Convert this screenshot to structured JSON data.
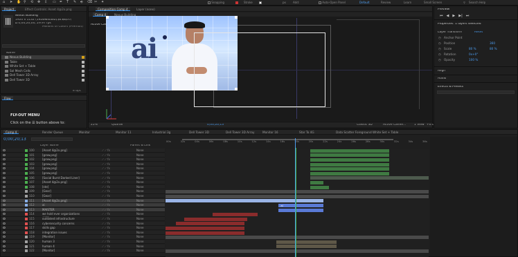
{
  "toolbar": {
    "snapping_label": "Snapping",
    "stroke_label": "Stroke",
    "stroke_value": "px",
    "add_label": "Add:",
    "auto_open_label": "Auto-Open Panel",
    "workspaces": [
      "Default",
      "Review",
      "Learn",
      "Small Screen"
    ],
    "search_placeholder": "Search Help"
  },
  "project": {
    "tabs": [
      "Project",
      "Effect Controls: Asset 4@2x.png"
    ],
    "item_name": "Nexus Building",
    "item_info": [
      "1920 x 1132 (1920 x 1132) (1.00)",
      "Δ 0;00;20;00, 29.97 fps"
    ],
    "item_info2": [
      "1920 x 1132 (1.00)",
      "Millions of Colors (Premult)"
    ],
    "col_name": "Name",
    "items": [
      {
        "name": "Nexus Building",
        "color": "#d4a017",
        "selected": true
      },
      {
        "name": "Table",
        "color": "#b8b8b8"
      },
      {
        "name": "White Set + Table",
        "color": "#b8b8b8"
      },
      {
        "name": "Sol Mesh Cells",
        "color": "#b8b8b8"
      },
      {
        "name": "Dell Tower 3D Array",
        "color": "#b8b8b8"
      },
      {
        "name": "Dell Tower 3D",
        "color": "#b8b8b8"
      }
    ],
    "bpc": "8 bpc"
  },
  "flow": {
    "tab": "Flow",
    "title": "FLY-OUT MENU",
    "instruction": "Click on the ☰ button above to:"
  },
  "comp": {
    "tabs": [
      "Composition Comp 4",
      "Layer (none)"
    ],
    "subtabs": [
      "Comp 4",
      "Nexus Building"
    ],
    "active_camera_label": "Active Camera (Camera 1)",
    "footer": {
      "zoom": "25%",
      "resolution": "Quarter",
      "timecode": "0;00;20;13",
      "renderer": "Classic 3D",
      "camera": "Active Camer...",
      "views": "1 View",
      "offset": "+0.0"
    }
  },
  "video": {
    "logo_text": "ai"
  },
  "right": {
    "preview_label": "Preview",
    "properties_label": "Properties: 1 layers selected",
    "layer_transform_label": "Layer Transform",
    "reset_label": "Reset",
    "props": [
      {
        "label": "Anchor Point",
        "value": "",
        "value2": ""
      },
      {
        "label": "Position",
        "value": "",
        "value2": "360"
      },
      {
        "label": "Scale",
        "value": "80 %",
        "value2": "80 %"
      },
      {
        "label": "Rotation",
        "value": "0x+0°",
        "value2": ""
      },
      {
        "label": "Opacity",
        "value": "100 %",
        "value2": ""
      }
    ],
    "align_label": "Align",
    "audio_label": "Audio",
    "effects_label": "Effects & Presets"
  },
  "timeline": {
    "tabs": [
      "Comp 4",
      "Render Queue",
      "Monitor",
      "Monitor 11",
      "Industrial 3g",
      "Dell Tower 3D",
      "Dell Tower 3D Array",
      "Monitor 16",
      "Star To 4G",
      "Data Scatter Foreground",
      "White Set + Table"
    ],
    "timecode": "0;00;20;13",
    "col_layer": "Layer Name",
    "col_parent": "Parent & Link",
    "ticks": [
      "00s",
      "02s",
      "04s",
      "06s",
      "08s",
      "10s",
      "12s",
      "14s",
      "16s",
      "18s",
      "20s",
      "22s",
      "24s",
      "26s",
      "28s",
      "30s",
      "32s",
      "34s",
      "36s"
    ],
    "playhead_fraction": 0.53,
    "layers": [
      {
        "num": "100",
        "name": "[Asset 4@2x.png]",
        "color": "#4caf50",
        "parent": "None"
      },
      {
        "num": "101",
        "name": "[grow.png]",
        "color": "#4caf50",
        "parent": "None"
      },
      {
        "num": "102",
        "name": "[grow.png]",
        "color": "#4caf50",
        "parent": "None"
      },
      {
        "num": "103",
        "name": "[grow.png]",
        "color": "#4caf50",
        "parent": "None"
      },
      {
        "num": "104",
        "name": "[grow.png]",
        "color": "#4caf50",
        "parent": "None"
      },
      {
        "num": "105",
        "name": "[grow.png]",
        "color": "#4caf50",
        "parent": "None"
      },
      {
        "num": "106",
        "name": "[Social Burst Darked Liner]",
        "color": "#4caf50",
        "parent": "None"
      },
      {
        "num": "107",
        "name": "[Asset 4@2x.png]",
        "color": "#4caf50",
        "parent": "None"
      },
      {
        "num": "108",
        "name": "[ste]",
        "color": "#4caf50",
        "parent": "None"
      },
      {
        "num": "109",
        "name": "[Gear]",
        "color": "#a0a0a0",
        "parent": "None"
      },
      {
        "num": "110",
        "name": "[Gear]",
        "color": "#a0a0a0",
        "parent": "None"
      },
      {
        "num": "111",
        "name": "[Asset 4@2x.png]",
        "color": "#8ab0e8",
        "parent": "None",
        "selected": true
      },
      {
        "num": "112",
        "name": "ai",
        "color": "#8ab0e8",
        "parent": "None",
        "selected": true
      },
      {
        "num": "113",
        "name": "MAISTER",
        "color": "#8ab0e8",
        "parent": "None",
        "selected": true
      },
      {
        "num": "114",
        "name": "we hold ever organizations (MCI)",
        "color": "#e05050",
        "parent": "None"
      },
      {
        "num": "115",
        "name": "outdated infrastructure",
        "color": "#e05050",
        "parent": "None"
      },
      {
        "num": "116",
        "name": "cybersecurity concerns",
        "color": "#e05050",
        "parent": "None"
      },
      {
        "num": "117",
        "name": "skills gap",
        "color": "#e05050",
        "parent": "None"
      },
      {
        "num": "118",
        "name": "integration issues",
        "color": "#e05050",
        "parent": "None"
      },
      {
        "num": "119",
        "name": "[Monitor]",
        "color": "#a0a0a0",
        "parent": "None"
      },
      {
        "num": "120",
        "name": "human 3",
        "color": "#a0a0a0",
        "parent": "None"
      },
      {
        "num": "121",
        "name": "human 4",
        "color": "#a0a0a0",
        "parent": "None"
      },
      {
        "num": "122",
        "name": "[Monitor]",
        "color": "#a0a0a0",
        "parent": "None"
      }
    ],
    "bars": [
      {
        "row": 0,
        "start": 0.55,
        "end": 0.85,
        "color": "#3f7a42",
        "label": ""
      },
      {
        "row": 1,
        "start": 0.55,
        "end": 0.85,
        "color": "#3f7a42",
        "label": ""
      },
      {
        "row": 2,
        "start": 0.55,
        "end": 0.85,
        "color": "#3f7a42",
        "label": ""
      },
      {
        "row": 3,
        "start": 0.55,
        "end": 0.85,
        "color": "#3f7a42",
        "label": ""
      },
      {
        "row": 4,
        "start": 0.55,
        "end": 0.85,
        "color": "#3f7a42",
        "label": ""
      },
      {
        "row": 5,
        "start": 0.55,
        "end": 0.85,
        "color": "#3f7a42",
        "label": ""
      },
      {
        "row": 6,
        "start": 0.55,
        "end": 1.0,
        "color": "#4d5a4d",
        "label": ""
      },
      {
        "row": 7,
        "start": 0.55,
        "end": 0.6,
        "color": "#3f7a42",
        "label": ""
      },
      {
        "row": 8,
        "start": 0.55,
        "end": 0.62,
        "color": "#3f7a42",
        "label": ""
      },
      {
        "row": 9,
        "start": 0.0,
        "end": 1.0,
        "color": "#4a4a4a",
        "label": ""
      },
      {
        "row": 10,
        "start": 0.0,
        "end": 1.0,
        "color": "#4a4a4a",
        "label": ""
      },
      {
        "row": 11,
        "start": 0.0,
        "end": 0.6,
        "color": "#9ab4e6",
        "label": ""
      },
      {
        "row": 12,
        "start": 0.43,
        "end": 0.6,
        "color": "#5a7ad6",
        "label": "ai"
      },
      {
        "row": 13,
        "start": 0.43,
        "end": 0.6,
        "color": "#5a7ad6",
        "label": ""
      },
      {
        "row": 14,
        "start": 0.18,
        "end": 0.35,
        "color": "#8a2c2c",
        "label": ""
      },
      {
        "row": 15,
        "start": 0.07,
        "end": 0.31,
        "color": "#8a2c2c",
        "label": ""
      },
      {
        "row": 16,
        "start": 0.04,
        "end": 0.3,
        "color": "#8a2c2c",
        "label": ""
      },
      {
        "row": 17,
        "start": 0.0,
        "end": 0.3,
        "color": "#8a2c2c",
        "label": ""
      },
      {
        "row": 18,
        "start": 0.0,
        "end": 0.3,
        "color": "#8a2c2c",
        "label": ""
      },
      {
        "row": 19,
        "start": 0.0,
        "end": 1.0,
        "color": "#4a4a4a",
        "label": ""
      },
      {
        "row": 20,
        "start": 0.42,
        "end": 0.65,
        "color": "#5f5848",
        "label": ""
      },
      {
        "row": 21,
        "start": 0.42,
        "end": 0.65,
        "color": "#5f5848",
        "label": ""
      },
      {
        "row": 22,
        "start": 0.0,
        "end": 1.0,
        "color": "#4a4a4a",
        "label": ""
      }
    ]
  },
  "colors": {
    "accent": "#2d8ceb",
    "timecode": "#4c9df0",
    "playhead": "#4c9df0"
  }
}
